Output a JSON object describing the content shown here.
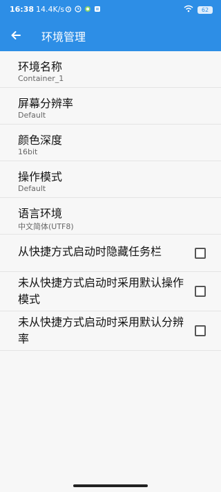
{
  "status_bar": {
    "time": "16:38",
    "speed": "14.4K/s",
    "battery": "62",
    "icons": [
      "alarm-icon",
      "clock-icon",
      "app-status-icon",
      "notification-icon",
      "wifi-icon",
      "battery-icon"
    ]
  },
  "app_bar": {
    "title": "环境管理",
    "back_icon": "arrow-left-icon"
  },
  "settings": [
    {
      "title": "环境名称",
      "value": "Container_1"
    },
    {
      "title": "屏幕分辨率",
      "value": "Default"
    },
    {
      "title": "颜色深度",
      "value": "16bit"
    },
    {
      "title": "操作模式",
      "value": "Default"
    },
    {
      "title": "语言环境",
      "value": "中文简体(UTF8)"
    }
  ],
  "checkboxes": [
    {
      "label": "从快捷方式启动时隐藏任务栏",
      "checked": false
    },
    {
      "label": "未从快捷方式启动时采用默认操作模式",
      "checked": false
    },
    {
      "label": "未从快捷方式启动时采用默认分辨率",
      "checked": false
    }
  ],
  "colors": {
    "primary": "#2d8ee6",
    "background": "#f7f7f7",
    "divider": "#e4e4e4"
  }
}
